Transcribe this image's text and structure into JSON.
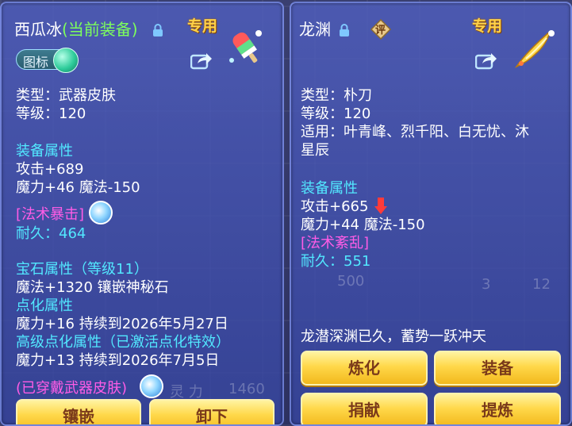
{
  "left": {
    "name": "西瓜冰",
    "equipped_tag": "(当前装备)",
    "exclusive_label": "专用",
    "badge_label": "图标",
    "type_line": "类型：武器皮肤",
    "level_line": "等级：120",
    "equip_attr_title": "装备属性",
    "attack": "攻击+689",
    "magic": "魔力+46 魔法-150",
    "special_skill": "[法术暴击]",
    "durability": "耐久：464",
    "gem_title": "宝石属性（等级11）",
    "gem_value": "魔法+1320 镶嵌神秘石",
    "enhance_title": "点化属性",
    "enhance_value": "魔力+16 持续到2026年5月27日",
    "adv_enhance_title": "高级点化属性（已激活点化特效）",
    "adv_enhance_value": "魔力+13 持续到2026年7月5日",
    "skin_status": "(已穿戴武器皮肤)",
    "buttons": [
      "镶嵌",
      "卸下"
    ],
    "bg_faint": [
      "500",
      "1460",
      "灵 力"
    ]
  },
  "right": {
    "name": "龙渊",
    "seal_char": "评",
    "exclusive_label": "专用",
    "type_line": "类型：朴刀",
    "level_line": "等级：120",
    "usable_line1": "适用：叶青峰、烈千阳、白无忧、沐",
    "usable_line2": "星辰",
    "equip_attr_title": "装备属性",
    "attack": "攻击+665",
    "magic": "魔力+44 魔法-150",
    "special_skill": "[法术紊乱]",
    "durability": "耐久：551",
    "description": "龙潜深渊已久，蓄势一跃冲天",
    "buttons": [
      "炼化",
      "装备",
      "捐献",
      "提炼"
    ],
    "bg_faint": [
      "3",
      "12"
    ]
  },
  "colors": {
    "white": "#ffffff",
    "cyan": "#52e8ff",
    "magenta": "#ff5ce6",
    "yellow": "#ffe34d",
    "green_tag": "#7dff5c",
    "down_arrow": "#ff3b3b"
  },
  "icons": [
    "lock-icon",
    "share-icon",
    "popsicle-weapon-icon",
    "dragon-blade-icon",
    "swirl-icon",
    "down-arrow-icon",
    "seal-icon",
    "orb-icon"
  ]
}
